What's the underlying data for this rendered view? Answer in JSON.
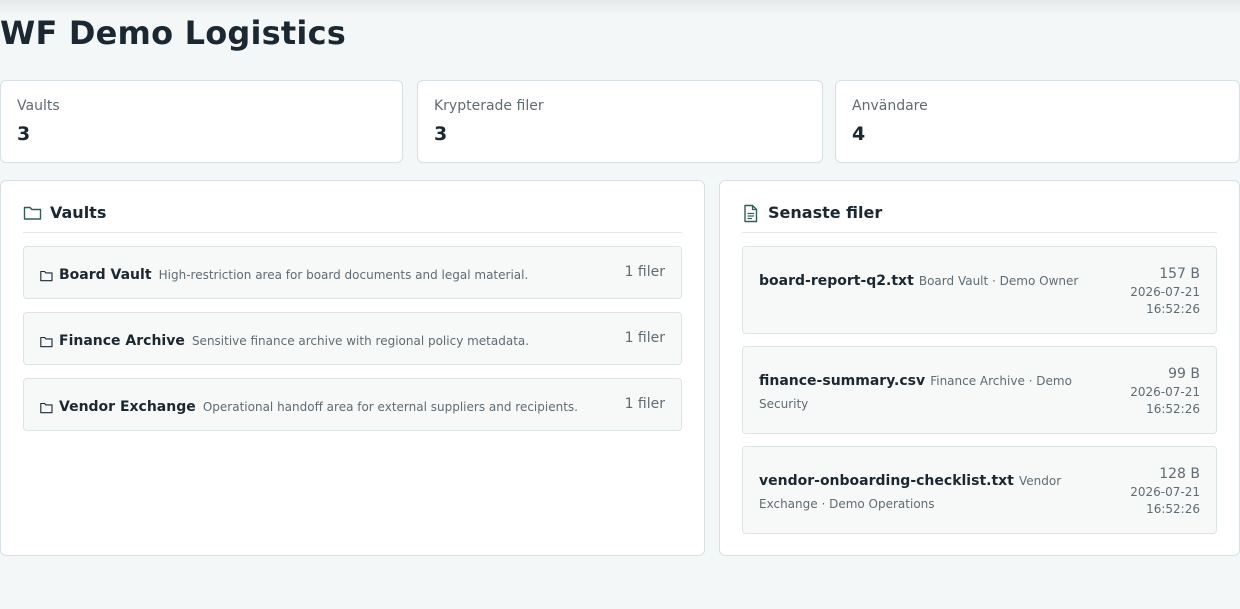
{
  "page": {
    "title": "WF Demo Logistics"
  },
  "stats": [
    {
      "label": "Vaults",
      "value": "3"
    },
    {
      "label": "Krypterade filer",
      "value": "3"
    },
    {
      "label": "Användare",
      "value": "4"
    }
  ],
  "vaults_panel": {
    "title": "Vaults",
    "icon": "folder-icon",
    "items": [
      {
        "name": "Board Vault",
        "description": "High-restriction area for board documents and legal material.",
        "count": "1 filer"
      },
      {
        "name": "Finance Archive",
        "description": "Sensitive finance archive with regional policy metadata.",
        "count": "1 filer"
      },
      {
        "name": "Vendor Exchange",
        "description": "Operational handoff area for external suppliers and recipients.",
        "count": "1 filer"
      }
    ]
  },
  "files_panel": {
    "title": "Senaste filer",
    "icon": "document-icon",
    "items": [
      {
        "name": "board-report-q2.txt",
        "meta": "Board Vault · Demo Owner",
        "size": "157 B",
        "date": "2026-07-21",
        "time": "16:52:26"
      },
      {
        "name": "finance-summary.csv",
        "meta": "Finance Archive · Demo Security",
        "size": "99 B",
        "date": "2026-07-21",
        "time": "16:52:26"
      },
      {
        "name": "vendor-onboarding-checklist.txt",
        "meta": "Vendor Exchange · Demo Operations",
        "size": "128 B",
        "date": "2026-07-21",
        "time": "16:52:26"
      }
    ]
  },
  "colors": {
    "background": "#f4f7f8",
    "card": "#ffffff",
    "border": "#d6e0e3",
    "row_background": "#f7f9f9",
    "text": "#1b2731",
    "muted_text": "#5f6b72",
    "icon_accent": "#2f5f58"
  }
}
